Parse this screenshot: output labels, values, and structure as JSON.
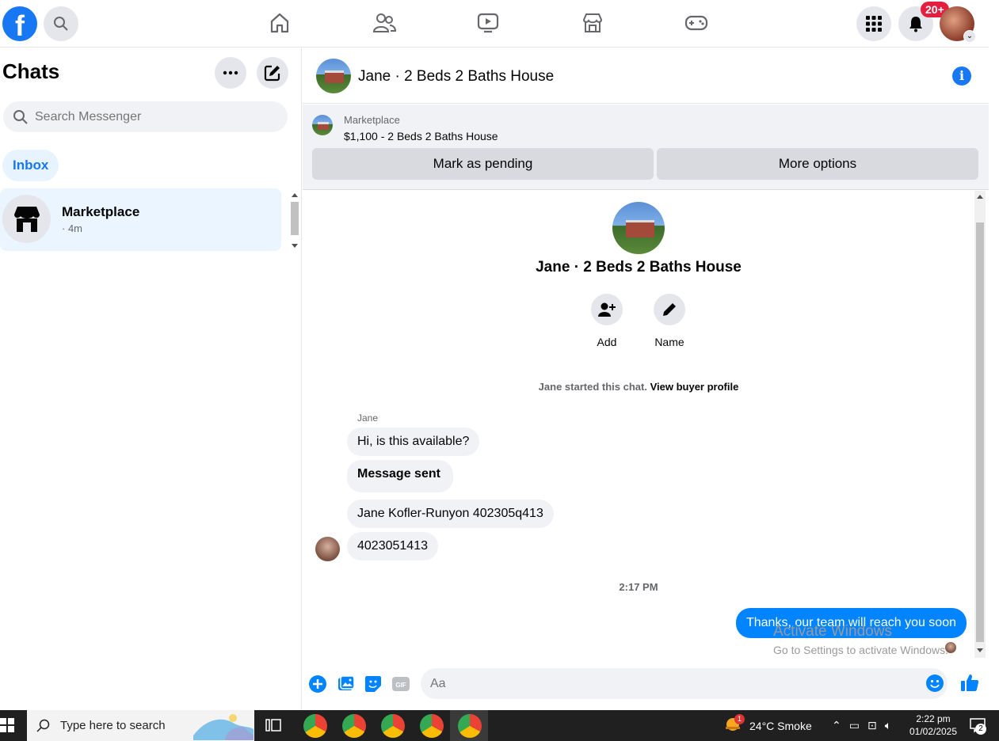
{
  "topbar": {
    "logo_letter": "f",
    "notifications_badge": "20+",
    "nav_icons": [
      "home-icon",
      "friends-icon",
      "watch-icon",
      "marketplace-icon",
      "gaming-icon"
    ]
  },
  "sidebar": {
    "title": "Chats",
    "search_placeholder": "Search Messenger",
    "filter_label": "Inbox",
    "conversations": [
      {
        "name": "Marketplace",
        "time": "· 4m"
      }
    ]
  },
  "chat": {
    "header_title": "Jane · 2 Beds 2 Baths House",
    "marketplace_label": "Marketplace",
    "listing": "$1,100 - 2 Beds 2 Baths House",
    "mark_pending_label": "Mark as pending",
    "more_options_label": "More options",
    "profile_name": "Jane · 2 Beds 2 Baths House",
    "add_label": "Add",
    "name_label": "Name",
    "started_text": "Jane started this chat.",
    "view_profile_link": "View buyer profile",
    "sender_name": "Jane",
    "incoming": [
      "Hi, is this available?",
      "Message sent",
      "Jane Kofler-Runyon 402305q413",
      "4023051413"
    ],
    "time_separator": "2:17 PM",
    "outgoing": "Thanks, our team will reach you soon",
    "watermark_title": "Activate Windows",
    "watermark_sub": "Go to Settings to activate Windows.",
    "composer_placeholder": "Aa"
  },
  "taskbar": {
    "search_placeholder": "Type here to search",
    "weather": "24°C  Smoke",
    "time": "2:22 pm",
    "date": "01/02/2025",
    "notif_count": "2",
    "weather_badge": "1"
  }
}
